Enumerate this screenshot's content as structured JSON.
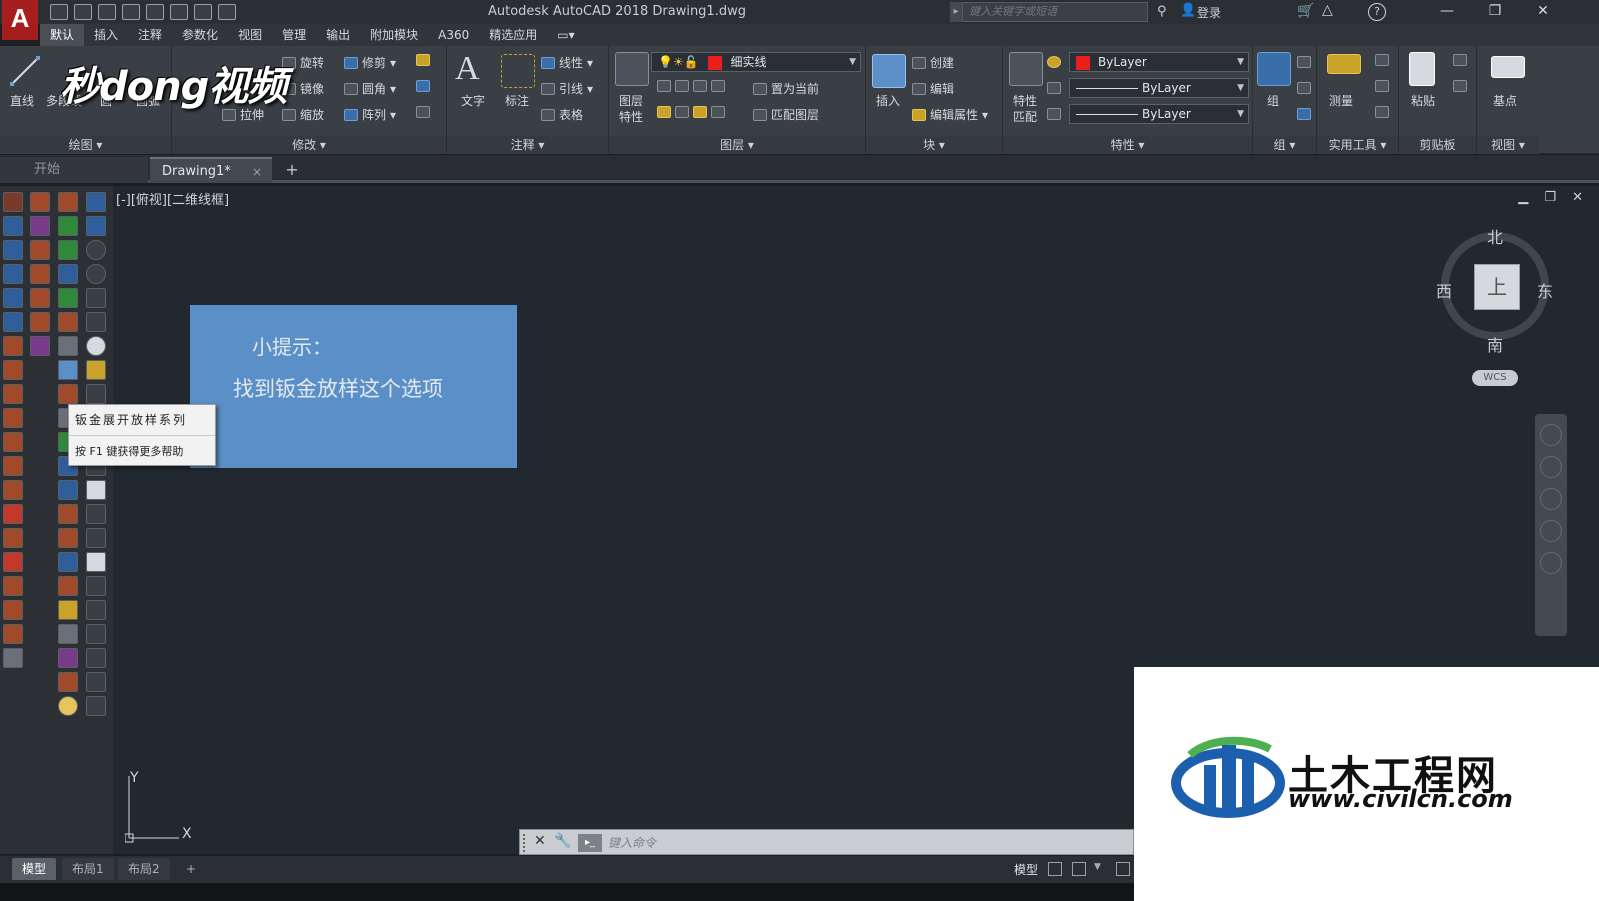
{
  "window": {
    "title": "Autodesk AutoCAD 2018    Drawing1.dwg",
    "app_logo": "A",
    "search_placeholder": "键入关键字或短语",
    "login": "登录",
    "min": "—",
    "max": "❐",
    "close": "✕"
  },
  "menu": [
    "默认",
    "插入",
    "注释",
    "参数化",
    "视图",
    "管理",
    "输出",
    "附加模块",
    "A360",
    "精选应用"
  ],
  "ribbon": {
    "draw": {
      "title": "绘图",
      "line": "直线",
      "polyline": "多段线",
      "circle": "圆",
      "arc": "圆弧"
    },
    "modify": {
      "title": "修改",
      "rotate": "旋转",
      "trim": "修剪",
      "mirror": "镜像",
      "fillet": "圆角",
      "stretch": "拉伸",
      "scale": "缩放",
      "array": "阵列"
    },
    "annotation": {
      "title": "注释",
      "text": "文字",
      "dimension": "标注",
      "linear": "线性",
      "leader": "引线",
      "table": "表格"
    },
    "layers": {
      "title": "图层",
      "properties_line1": "图层",
      "properties_line2": "特性",
      "current_layer": "细实线",
      "make_current": "置为当前",
      "match_layer": "匹配图层"
    },
    "block": {
      "title": "块",
      "insert": "插入",
      "create": "创建",
      "edit": "编辑",
      "edit_attributes": "编辑属性"
    },
    "properties": {
      "title": "特性",
      "match_line1": "特性",
      "match_line2": "匹配",
      "color": "ByLayer",
      "linetype": "ByLayer",
      "lineweight": "ByLayer"
    },
    "groups": {
      "title": "组",
      "group": "组"
    },
    "utilities": {
      "title": "实用工具",
      "measure": "测量"
    },
    "clipboard": {
      "title": "剪贴板",
      "paste": "粘贴"
    },
    "view": {
      "title": "视图",
      "base": "基点"
    }
  },
  "tabs": {
    "start": "开始",
    "drawing": "Drawing1*",
    "close": "×",
    "add": "+"
  },
  "viewport": {
    "label": "[-][俯视][二维线框]",
    "controls": "▁ ❐ ✕"
  },
  "viewcube": {
    "north": "北",
    "south": "南",
    "east": "东",
    "west": "西",
    "top": "上",
    "wcs": "WCS"
  },
  "tip": {
    "title": "小提示：",
    "body": "找到钣金放样这个选项"
  },
  "tooltip": {
    "title": "钣金展开放样系列",
    "help": "按 F1 键获得更多帮助"
  },
  "ucs": {
    "x": "X",
    "y": "Y"
  },
  "command": {
    "placeholder": "键入命令",
    "close": "✕",
    "settings": "🔧",
    "prompt": "▸_"
  },
  "layouts": [
    "模型",
    "布局1",
    "布局2"
  ],
  "layout_add": "+",
  "status": {
    "model": "模型"
  },
  "watermarks": {
    "mido": "秒dong视频",
    "civil_title": "土木工程网",
    "civil_url": "www.civilcn.com"
  },
  "colors": {
    "accent": "#5f95d1",
    "bylayer_red": "#e8201a",
    "canvas": "#212830"
  }
}
